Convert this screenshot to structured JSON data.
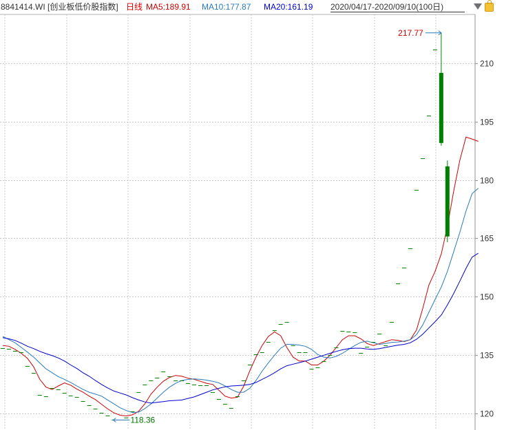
{
  "header": {
    "code_name": "8841414.WI [创业板低价股指数]",
    "period": "日线",
    "ma5_label": "MA5:189.91",
    "ma10_label": "MA10:177.87",
    "ma20_label": "MA20:161.19",
    "date_range": "2020/04/17-2020/09/10(100日)",
    "dropdown_icon": "triangle-down-icon",
    "lock_icon": "lock-icon"
  },
  "colors": {
    "ma5": "#cc0000",
    "ma10": "#2a7ab8",
    "ma20": "#0000cc",
    "up": "#ff0000",
    "down": "#008000",
    "grid": "#c8c8c8"
  },
  "chart_data": {
    "type": "candlestick",
    "y_ticks": [
      120,
      135,
      150,
      165,
      180,
      195,
      210
    ],
    "ylim": [
      115.8,
      222.5
    ],
    "grid": true,
    "annotations": {
      "high_label": "217.77",
      "low_label": "118.36"
    },
    "series": [
      {
        "name": "MA5",
        "values": [
          137.5,
          137.3,
          136.5,
          135.5,
          134.2,
          132,
          128.8,
          126.8,
          126.2,
          127.1,
          127.9,
          127.3,
          126.3,
          125.5,
          124.5,
          123.6,
          122.4,
          121.2,
          120.2,
          119.6,
          119.4,
          119.7,
          120.6,
          122.5,
          125.0,
          126.8,
          128.3,
          129.3,
          129.8,
          129.6,
          129.1,
          128.8,
          128.3,
          127.8,
          127.5,
          126.0,
          124.5,
          124.0,
          124.2,
          127.0,
          131.0,
          134.5,
          137.5,
          139.8,
          141.0,
          140.0,
          137.0,
          134.5,
          133.5,
          133.5,
          132.5,
          132.5,
          133.5,
          135.0,
          137.0,
          139.0,
          140.0,
          140.0,
          139.2,
          138.0,
          137.5,
          138.0,
          138.5,
          139.0,
          138.8,
          138.5,
          139.0,
          141.5,
          147.0,
          153.0,
          156.5,
          161.0,
          168.0,
          177.0,
          185.0,
          191.0,
          190.5,
          189.91
        ]
      },
      {
        "name": "MA10",
        "values": [
          139.8,
          139.0,
          138.2,
          137.0,
          135.8,
          134.5,
          133.0,
          131.5,
          130.5,
          129.5,
          128.8,
          128.0,
          127.1,
          126.2,
          125.5,
          125.0,
          124.5,
          123.5,
          122.5,
          121.5,
          120.8,
          120.3,
          120.4,
          121.3,
          122.5,
          124.0,
          125.5,
          126.8,
          127.8,
          128.5,
          128.8,
          128.9,
          128.8,
          128.6,
          128.3,
          127.9,
          127.1,
          126.2,
          125.5,
          125.5,
          126.5,
          128.5,
          130.9,
          133.0,
          135.0,
          136.8,
          137.8,
          137.8,
          137.6,
          137.3,
          136.5,
          135.2,
          134.5,
          134.3,
          134.7,
          135.5,
          136.5,
          137.5,
          138.3,
          138.6,
          138.2,
          137.8,
          138.0,
          138.3,
          138.4,
          138.6,
          139.0,
          140.3,
          142.8,
          146.0,
          149.3,
          152.5,
          156.5,
          161.5,
          166.5,
          172.0,
          176.5,
          177.87
        ]
      },
      {
        "name": "MA20",
        "values": [
          139.5,
          139.2,
          138.8,
          138.1,
          137.3,
          136.7,
          136.0,
          135.4,
          134.9,
          134.3,
          133.5,
          132.5,
          131.6,
          130.5,
          129.6,
          128.5,
          127.5,
          126.6,
          125.8,
          125.3,
          124.8,
          124.1,
          123.5,
          123.0,
          122.7,
          122.9,
          123.1,
          123.3,
          123.4,
          123.5,
          123.9,
          124.3,
          124.9,
          125.5,
          126.1,
          126.5,
          126.9,
          127.1,
          127.2,
          127.3,
          127.5,
          128.0,
          128.8,
          129.6,
          130.5,
          131.5,
          132.3,
          132.7,
          133.1,
          133.5,
          134.0,
          134.5,
          135.0,
          135.5,
          136.0,
          136.4,
          136.7,
          136.8,
          136.8,
          136.6,
          136.5,
          136.7,
          137.0,
          137.3,
          137.6,
          137.8,
          138.2,
          139.1,
          140.4,
          142.0,
          143.6,
          145.3,
          147.9,
          150.8,
          154.0,
          157.3,
          160.2,
          161.19
        ]
      }
    ],
    "dash_candles": [
      {
        "i": 0,
        "v": 136.8
      },
      {
        "i": 1,
        "v": 136.6
      },
      {
        "i": 2,
        "v": 136.2
      },
      {
        "i": 3,
        "v": 135.8
      },
      {
        "i": 4,
        "v": 132.2
      },
      {
        "i": 5,
        "v": 130.5
      },
      {
        "i": 6,
        "v": 124.8
      },
      {
        "i": 7,
        "v": 124.5
      },
      {
        "i": 8,
        "v": 126.6
      },
      {
        "i": 9,
        "v": 126.2
      },
      {
        "i": 10,
        "v": 125.3
      },
      {
        "i": 11,
        "v": 124.7
      },
      {
        "i": 12,
        "v": 124.2
      },
      {
        "i": 13,
        "v": 123.2
      },
      {
        "i": 14,
        "v": 122.2
      },
      {
        "i": 15,
        "v": 121.2
      },
      {
        "i": 16,
        "v": 120.3
      },
      {
        "i": 17,
        "v": 119.5
      },
      {
        "i": 18,
        "v": 118.4
      },
      {
        "i": 19,
        "v": 118.4
      },
      {
        "i": 20,
        "v": 119.0
      },
      {
        "i": 21,
        "v": 120.5
      },
      {
        "i": 22,
        "v": 125.5
      },
      {
        "i": 23,
        "v": 127.5
      },
      {
        "i": 24,
        "v": 128.5
      },
      {
        "i": 25,
        "v": 129.3
      },
      {
        "i": 26,
        "v": 130.8
      },
      {
        "i": 27,
        "v": 129.5
      },
      {
        "i": 28,
        "v": 128.5
      },
      {
        "i": 29,
        "v": 128.5
      },
      {
        "i": 30,
        "v": 127.8
      },
      {
        "i": 31,
        "v": 127.5
      },
      {
        "i": 32,
        "v": 127.3
      },
      {
        "i": 33,
        "v": 127.2
      },
      {
        "i": 34,
        "v": 125.5
      },
      {
        "i": 35,
        "v": 123.8
      },
      {
        "i": 36,
        "v": 122.5
      },
      {
        "i": 37,
        "v": 121.5
      },
      {
        "i": 38,
        "v": 124.5
      },
      {
        "i": 39,
        "v": 128.5
      },
      {
        "i": 40,
        "v": 132.5
      },
      {
        "i": 41,
        "v": 135.3
      },
      {
        "i": 42,
        "v": 135.8
      },
      {
        "i": 43,
        "v": 138.5
      },
      {
        "i": 44,
        "v": 141.5
      },
      {
        "i": 45,
        "v": 143.0
      },
      {
        "i": 46,
        "v": 143.5
      },
      {
        "i": 47,
        "v": 137.5
      },
      {
        "i": 48,
        "v": 135.8
      },
      {
        "i": 49,
        "v": 135.8
      },
      {
        "i": 50,
        "v": 131.5
      },
      {
        "i": 51,
        "v": 131.8
      },
      {
        "i": 52,
        "v": 133.5
      },
      {
        "i": 53,
        "v": 135.0
      },
      {
        "i": 54,
        "v": 137.0
      },
      {
        "i": 55,
        "v": 141.3
      },
      {
        "i": 56,
        "v": 141.0
      },
      {
        "i": 57,
        "v": 140.8
      },
      {
        "i": 58,
        "v": 135.5
      },
      {
        "i": 59,
        "v": 137.2
      },
      {
        "i": 60,
        "v": 138.5
      },
      {
        "i": 61,
        "v": 140.5
      },
      {
        "i": 62,
        "v": 137.5
      },
      {
        "i": 63,
        "v": 143.5
      },
      {
        "i": 64,
        "v": 153.5
      },
      {
        "i": 65,
        "v": 157.5
      },
      {
        "i": 66,
        "v": 162.5
      },
      {
        "i": 67,
        "v": 177.5
      },
      {
        "i": 68,
        "v": 185.5
      },
      {
        "i": 69,
        "v": 196.5
      },
      {
        "i": 70,
        "v": 213.5
      }
    ],
    "body_candles": [
      {
        "x_index": 71,
        "open": 207.5,
        "close": 189.5,
        "high": 217.77,
        "low": 188.8
      },
      {
        "x_index": 72,
        "open": 183.5,
        "close": 165.5,
        "high": 185.0,
        "low": 164.0
      }
    ]
  }
}
